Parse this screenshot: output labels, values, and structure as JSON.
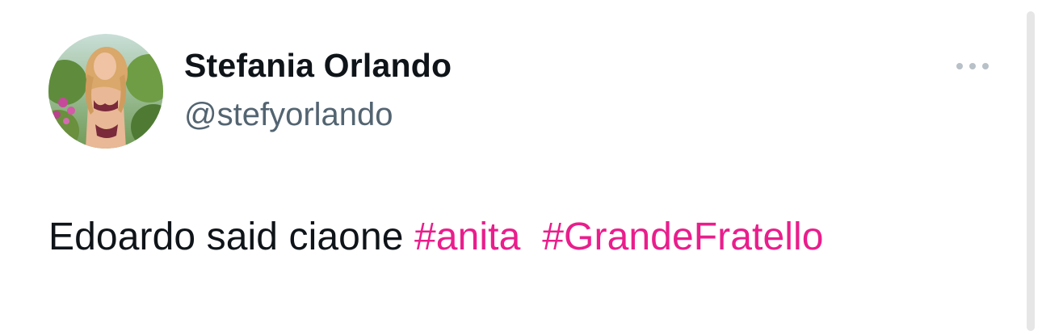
{
  "tweet": {
    "author": {
      "display_name": "Stefania Orlando",
      "handle": "@stefyorlando"
    },
    "text": {
      "plain": "Edoardo said ciaone ",
      "hashtags": [
        "#anita",
        "#GrandeFratello"
      ]
    },
    "more_icon": "ellipsis-horizontal-icon"
  },
  "colors": {
    "hashtag": "#e91e8c",
    "text": "#0f1419",
    "secondary": "#536471"
  }
}
